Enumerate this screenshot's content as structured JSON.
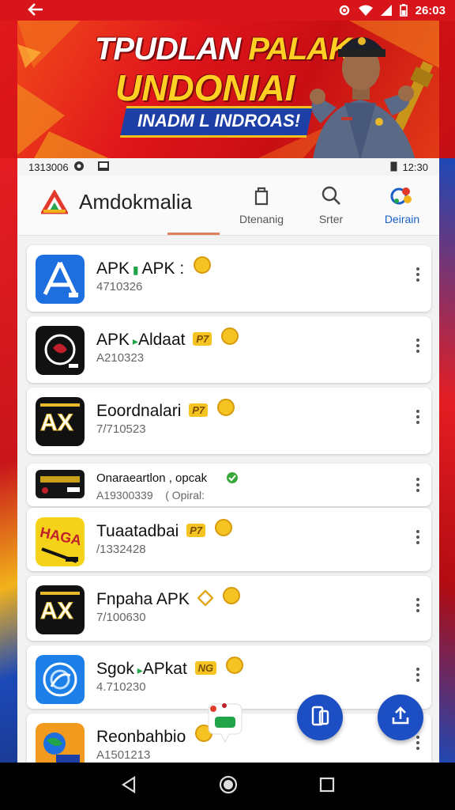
{
  "status_bar": {
    "time": "26:03"
  },
  "banner": {
    "title_line1_white": "TPUDLAN",
    "title_line1_gold": "PALAK",
    "title_line2": "UNDONIAI",
    "ribbon_text": "INADM L INDROAS!"
  },
  "inner_status": {
    "left_text": "1313006",
    "time": "12:30"
  },
  "header": {
    "app_title": "Amdokmalia",
    "tabs": [
      {
        "label": "Dtenanig"
      },
      {
        "label": "Srter"
      },
      {
        "label": "Deirain"
      }
    ]
  },
  "apps": [
    {
      "name": "APK",
      "name_mid": "APK :",
      "sub": "4710326",
      "icon": "blue-a-store-icon",
      "badge": ""
    },
    {
      "name": "APK",
      "name_mid": "Aldaat",
      "sub": "A210323",
      "icon": "black-red-emblem-icon",
      "badge": "P7"
    },
    {
      "name": "Eoordnalari",
      "name_mid": "",
      "sub": "7/710523",
      "icon": "ax-logo-icon",
      "badge": "P7"
    },
    {
      "name": "Onaraeartlon , opcak",
      "name_mid": "",
      "sub": "A19300339",
      "sub_extra": "( Opiral:",
      "icon": "dark-stripe-icon",
      "badge": ""
    },
    {
      "name": "Tuaatadbai",
      "name_mid": "",
      "sub": "/1332428",
      "icon": "yellow-game-icon",
      "badge": "P7"
    },
    {
      "name": "Fnpaha APK",
      "name_mid": "",
      "sub": "7/100630",
      "icon": "ax-logo-icon",
      "badge": ""
    },
    {
      "name": "Sgok",
      "name_mid": "APkat",
      "sub": "4.710230",
      "icon": "blue-swirl-icon",
      "badge": "NG"
    },
    {
      "name": "Reonbahbio",
      "name_mid": "",
      "sub": "A1501213",
      "icon": "orange-map-icon",
      "badge": ""
    }
  ],
  "colors": {
    "accent": "#1c4fc4",
    "banner_red": "#e0161b",
    "gold": "#f5c423"
  }
}
